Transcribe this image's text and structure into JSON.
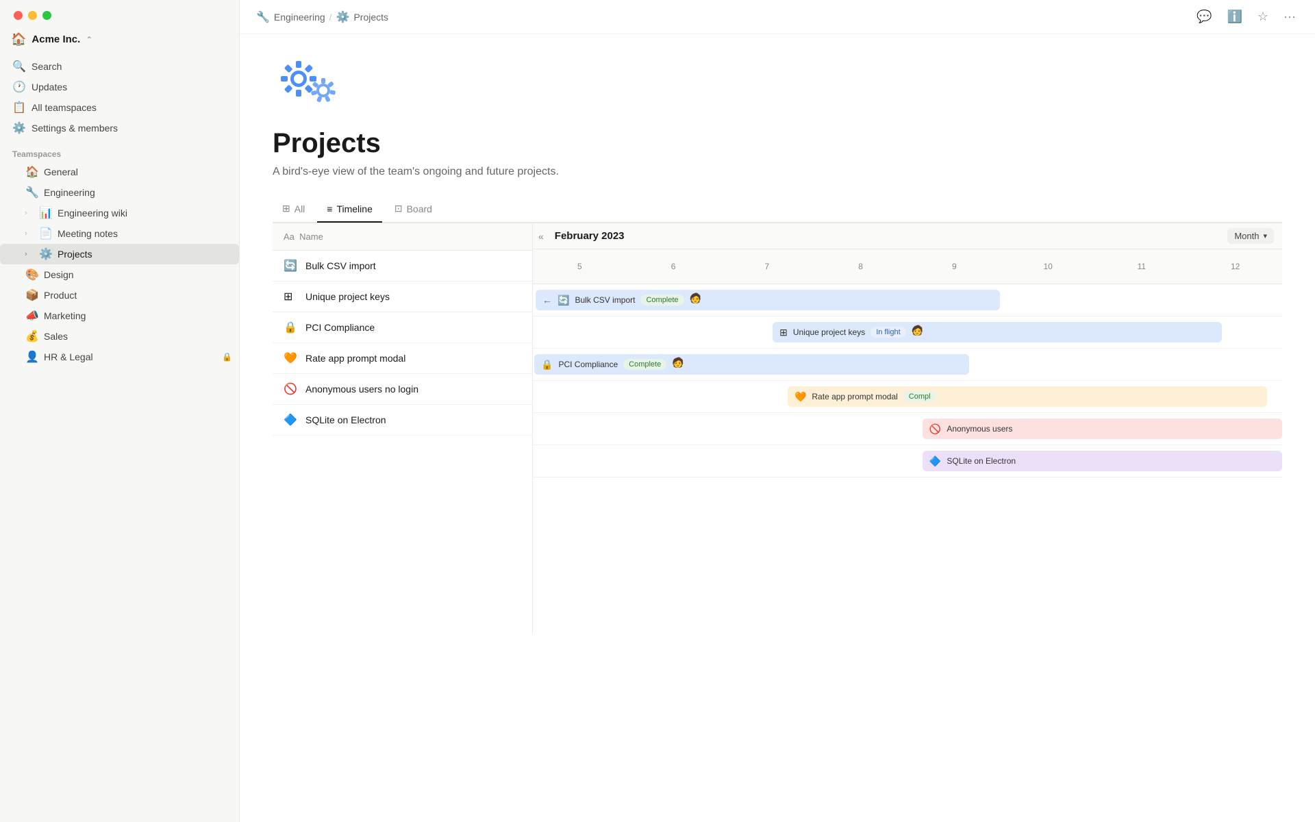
{
  "window": {
    "traffic_lights": [
      "red",
      "yellow",
      "green"
    ]
  },
  "sidebar": {
    "workspace": {
      "name": "Acme Inc.",
      "icon": "🏠",
      "chevron": "⌃"
    },
    "nav_items": [
      {
        "id": "search",
        "icon": "🔍",
        "label": "Search"
      },
      {
        "id": "updates",
        "icon": "🕐",
        "label": "Updates"
      },
      {
        "id": "all-teamspaces",
        "icon": "📋",
        "label": "All teamspaces"
      },
      {
        "id": "settings",
        "icon": "⚙️",
        "label": "Settings & members"
      }
    ],
    "section_label": "Teamspaces",
    "tree_items": [
      {
        "id": "general",
        "icon": "🏠",
        "label": "General",
        "chevron": "",
        "has_lock": false,
        "indent": 0
      },
      {
        "id": "engineering",
        "icon": "🔧",
        "label": "Engineering",
        "chevron": "",
        "has_lock": false,
        "indent": 0
      },
      {
        "id": "engineering-wiki",
        "icon": "📊",
        "label": "Engineering wiki",
        "chevron": ">",
        "has_lock": false,
        "indent": 1
      },
      {
        "id": "meeting-notes",
        "icon": "📄",
        "label": "Meeting notes",
        "chevron": ">",
        "has_lock": false,
        "indent": 1
      },
      {
        "id": "projects",
        "icon": "⚙️",
        "label": "Projects",
        "chevron": ">",
        "has_lock": false,
        "indent": 1,
        "active": true
      },
      {
        "id": "design",
        "icon": "🎨",
        "label": "Design",
        "chevron": "",
        "has_lock": false,
        "indent": 0
      },
      {
        "id": "product",
        "icon": "📦",
        "label": "Product",
        "chevron": "",
        "has_lock": false,
        "indent": 0
      },
      {
        "id": "marketing",
        "icon": "📣",
        "label": "Marketing",
        "chevron": "",
        "has_lock": false,
        "indent": 0
      },
      {
        "id": "sales",
        "icon": "💰",
        "label": "Sales",
        "chevron": "",
        "has_lock": false,
        "indent": 0
      },
      {
        "id": "hr-legal",
        "icon": "👤",
        "label": "HR & Legal",
        "chevron": "",
        "has_lock": true,
        "indent": 0
      }
    ]
  },
  "breadcrumb": {
    "items": [
      {
        "id": "engineering",
        "icon": "🔧",
        "label": "Engineering"
      },
      {
        "id": "projects",
        "icon": "⚙️",
        "label": "Projects"
      }
    ]
  },
  "topbar_actions": [
    {
      "id": "comment",
      "icon": "💬"
    },
    {
      "id": "info",
      "icon": "ℹ️"
    },
    {
      "id": "star",
      "icon": "☆"
    },
    {
      "id": "more",
      "icon": "···"
    }
  ],
  "page": {
    "icon": "⚙️",
    "title": "Projects",
    "description": "A bird's-eye view of the team's ongoing and future projects.",
    "tabs": [
      {
        "id": "all",
        "icon": "⊞",
        "label": "All"
      },
      {
        "id": "timeline",
        "icon": "≡",
        "label": "Timeline",
        "active": true
      },
      {
        "id": "board",
        "icon": "⊡",
        "label": "Board"
      }
    ]
  },
  "timeline": {
    "month_nav": {
      "collapse_icon": "«",
      "month_label": "February 2023",
      "view_mode": "Month"
    },
    "name_column_label": "Aa  Name",
    "dates": [
      5,
      6,
      7,
      8,
      9,
      10,
      11,
      12
    ],
    "rows": [
      {
        "id": "bulk-csv",
        "icon": "🔄",
        "label": "Bulk CSV import",
        "bar": {
          "left_pct": 0,
          "width_pct": 55,
          "bg": "#e8f0fb",
          "status": "Complete",
          "status_type": "complete",
          "has_back_arrow": true,
          "has_avatar": true
        }
      },
      {
        "id": "unique-keys",
        "icon": "⊞",
        "label": "Unique project keys",
        "bar": {
          "left_pct": 28,
          "width_pct": 55,
          "bg": "#e8f0fb",
          "status": "In flight",
          "status_type": "inflight",
          "has_back_arrow": false,
          "has_avatar": true
        }
      },
      {
        "id": "pci",
        "icon": "🔒",
        "label": "PCI Compliance",
        "bar": {
          "left_pct": 2,
          "width_pct": 52,
          "bg": "#e8f0fb",
          "status": "Complete",
          "status_type": "complete",
          "has_back_arrow": false,
          "has_avatar": true
        }
      },
      {
        "id": "rate-app",
        "icon": "🧡",
        "label": "Rate app prompt modal",
        "bar": {
          "left_pct": 30,
          "width_pct": 55,
          "bg": "#fef3e2",
          "status": "Complete",
          "status_type": "complete",
          "has_back_arrow": false,
          "has_avatar": false,
          "partial": true
        }
      },
      {
        "id": "anon-users",
        "icon": "🚫",
        "label": "Anonymous users no login",
        "bar": {
          "left_pct": 48,
          "width_pct": 45,
          "bg": "#fde8e8",
          "status": "",
          "status_type": "",
          "has_back_arrow": false,
          "has_avatar": false,
          "partial": true
        }
      },
      {
        "id": "sqlite",
        "icon": "🔷",
        "label": "SQLite on Electron",
        "bar": {
          "left_pct": 48,
          "width_pct": 45,
          "bg": "#f0e8fb",
          "status": "",
          "status_type": "",
          "has_back_arrow": false,
          "has_avatar": false,
          "partial": true
        }
      }
    ]
  }
}
